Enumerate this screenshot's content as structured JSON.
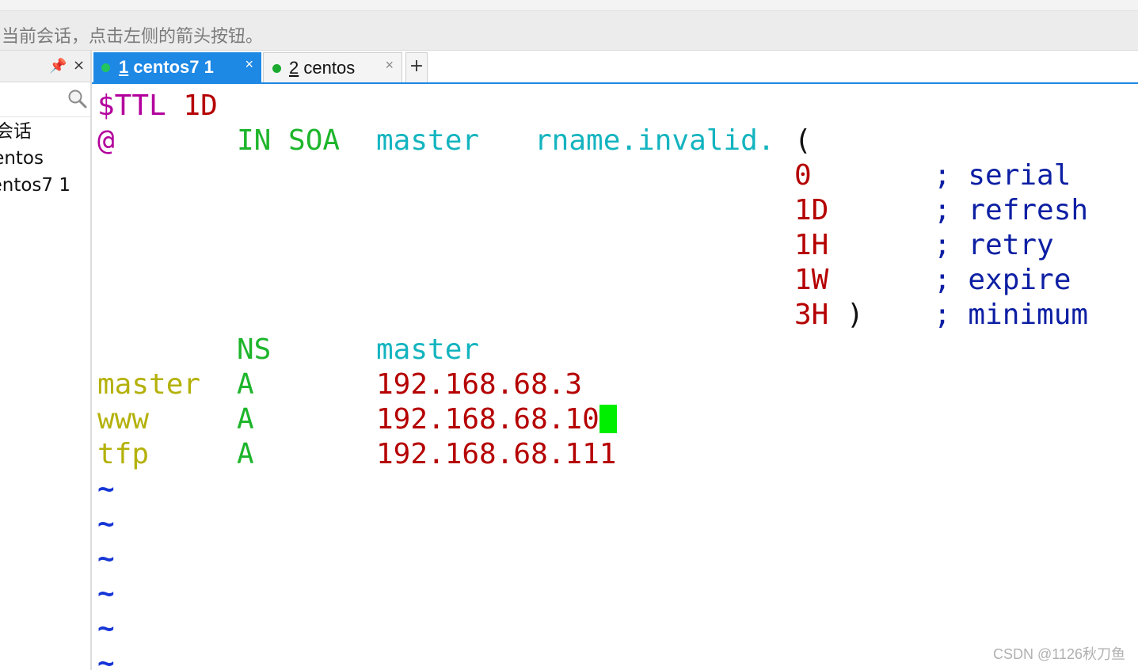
{
  "hint_bar": {
    "text": "当前会话，点击左侧的箭头按钮。"
  },
  "sidebar": {
    "items": [
      {
        "label": "会话"
      },
      {
        "label": "entos"
      },
      {
        "label": "entos7 1"
      }
    ]
  },
  "tabs": [
    {
      "number": "1",
      "title": "centos7 1",
      "active": true,
      "status_color": "#22c55e"
    },
    {
      "number": "2",
      "title": "centos",
      "active": false,
      "status_color": "#1aaa2f"
    }
  ],
  "tab_add_label": "+",
  "tab_close_label": "×",
  "terminal": {
    "ttl": {
      "directive": "$TTL",
      "value": "1D"
    },
    "soa": {
      "origin": "@",
      "class_type": "IN SOA",
      "mname": "master",
      "rname": "rname.invalid.",
      "open_paren": "("
    },
    "soa_fields": [
      {
        "value": "0",
        "comment": "; serial"
      },
      {
        "value": "1D",
        "comment": "; refresh"
      },
      {
        "value": "1H",
        "comment": "; retry"
      },
      {
        "value": "1W",
        "comment": "; expire"
      },
      {
        "value": "3H",
        "close_paren": ")",
        "comment": "; minimum"
      }
    ],
    "records": [
      {
        "name": "",
        "type": "NS",
        "data": "master"
      },
      {
        "name": "master",
        "type": "A",
        "data": "192.168.68.3"
      },
      {
        "name": "www",
        "type": "A",
        "data": "192.168.68.10"
      },
      {
        "name": "tfp",
        "type": "A",
        "data": "192.168.68.111"
      }
    ],
    "tilde": "~",
    "cursor_color": "#00ee00"
  },
  "watermark": "CSDN @1126秋刀鱼"
}
